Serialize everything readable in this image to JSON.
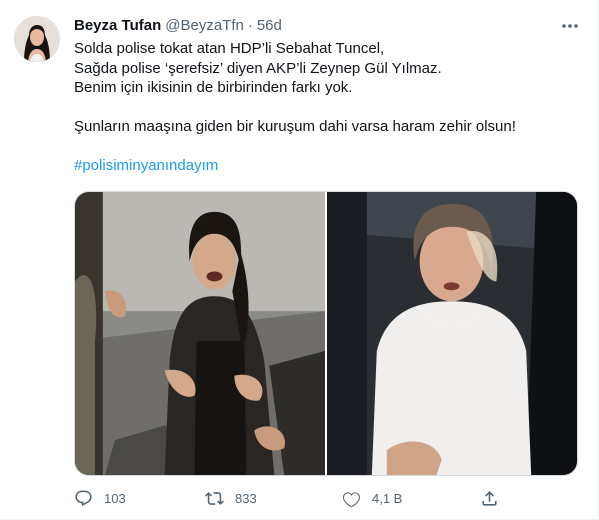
{
  "tweet": {
    "author": {
      "name": "Beyza Tufan",
      "handle": "@BeyzaTfn",
      "separator": "·",
      "time": "56d"
    },
    "text_lines": [
      "Solda polise tokat atan HDP’li Sebahat Tuncel,",
      "Sağda polise ‘şerefsiz’ diyen AKP’li Zeynep Gül Yılmaz.",
      "Benim için ikisinin de birbirinden farkı yok.",
      "Şunların maaşına giden bir kuruşum dahi varsa haram zehir olsun!"
    ],
    "hashtag": "#polisiminyanındayım",
    "media": [
      {
        "icon": "photo-left"
      },
      {
        "icon": "photo-right"
      }
    ],
    "actions": {
      "reply": {
        "icon": "reply-icon",
        "count": "103"
      },
      "retweet": {
        "icon": "retweet-icon",
        "count": "833"
      },
      "like": {
        "icon": "like-icon",
        "count": "4,1 B"
      },
      "share": {
        "icon": "share-icon"
      }
    },
    "colors": {
      "link": "#1d9bf0",
      "secondary": "#536471",
      "text": "#0f1419",
      "border": "#cfd9de"
    }
  }
}
